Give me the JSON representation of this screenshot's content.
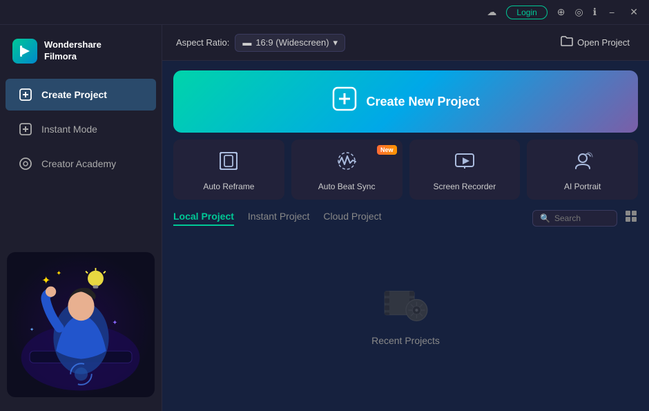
{
  "titlebar": {
    "login_label": "Login",
    "minimize": "−",
    "close": "✕"
  },
  "logo": {
    "text_line1": "Wondershare",
    "text_line2": "Filmora"
  },
  "sidebar": {
    "items": [
      {
        "id": "create-project",
        "label": "Create Project",
        "active": true
      },
      {
        "id": "instant-mode",
        "label": "Instant Mode",
        "active": false
      },
      {
        "id": "creator-academy",
        "label": "Creator Academy",
        "active": false
      }
    ]
  },
  "topbar": {
    "aspect_ratio_label": "Aspect Ratio:",
    "aspect_ratio_value": "16:9 (Widescreen)",
    "open_project_label": "Open Project"
  },
  "banner": {
    "label": "Create New Project"
  },
  "feature_cards": [
    {
      "id": "auto-reframe",
      "label": "Auto Reframe",
      "new": false
    },
    {
      "id": "auto-beat-sync",
      "label": "Auto Beat Sync",
      "new": true
    },
    {
      "id": "screen-recorder",
      "label": "Screen Recorder",
      "new": false
    },
    {
      "id": "ai-portrait",
      "label": "AI Portrait",
      "new": false
    }
  ],
  "tabs": {
    "items": [
      {
        "id": "local-project",
        "label": "Local Project",
        "active": true
      },
      {
        "id": "instant-project",
        "label": "Instant Project",
        "active": false
      },
      {
        "id": "cloud-project",
        "label": "Cloud Project",
        "active": false
      }
    ],
    "search_placeholder": "Search"
  },
  "empty_state": {
    "label": "Recent Projects"
  },
  "badges": {
    "new_label": "New"
  }
}
